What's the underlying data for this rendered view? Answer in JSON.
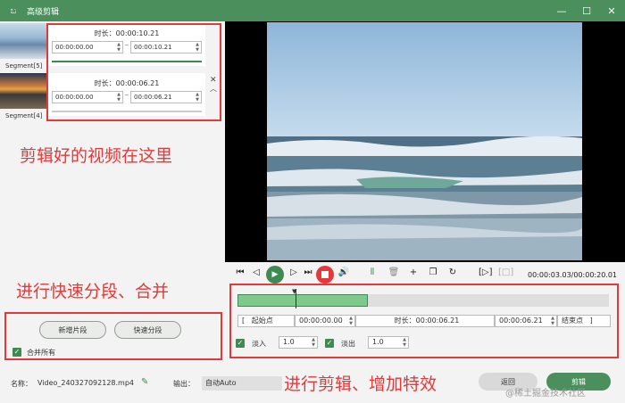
{
  "window": {
    "title": "高级剪辑"
  },
  "segments": [
    {
      "label": "Segment[5]",
      "duration": "时长：00:00:10.21",
      "start": "00:00:00.00",
      "end": "00:00:10.21"
    },
    {
      "label": "Segment[4]",
      "duration": "时长：00:00:06.21",
      "start": "00:00:00.00",
      "end": "00:00:06.21"
    }
  ],
  "annotations": {
    "clips_here": "剪辑好的视频在这里",
    "split_merge": "进行快速分段、合并",
    "edit_effects": "进行剪辑、增加特效"
  },
  "left_actions": {
    "new_segment": "新增片段",
    "quick_split": "快速分段",
    "merge_all": "合并所有"
  },
  "player": {
    "timecode": "00:00:03.03/00:00:20.01",
    "progress": 0.15
  },
  "editor": {
    "start_btn": "起始点",
    "start_value": "00:00:00.00",
    "duration": "时长：00:00:06.21",
    "end_value": "00:00:06.21",
    "end_btn": "结束点",
    "fade_in_label": "淡入",
    "fade_in_value": "1.0",
    "fade_out_label": "淡出",
    "fade_out_value": "1.0",
    "selection_fraction": 0.35
  },
  "footer": {
    "name_label": "名称：",
    "file_name": "Video_240327092128.mp4",
    "output_label": "输出：",
    "output_value": "自动Auto",
    "back_btn": "返回",
    "edit_btn": "剪辑"
  },
  "watermark": "@稀土掘金技术社区"
}
